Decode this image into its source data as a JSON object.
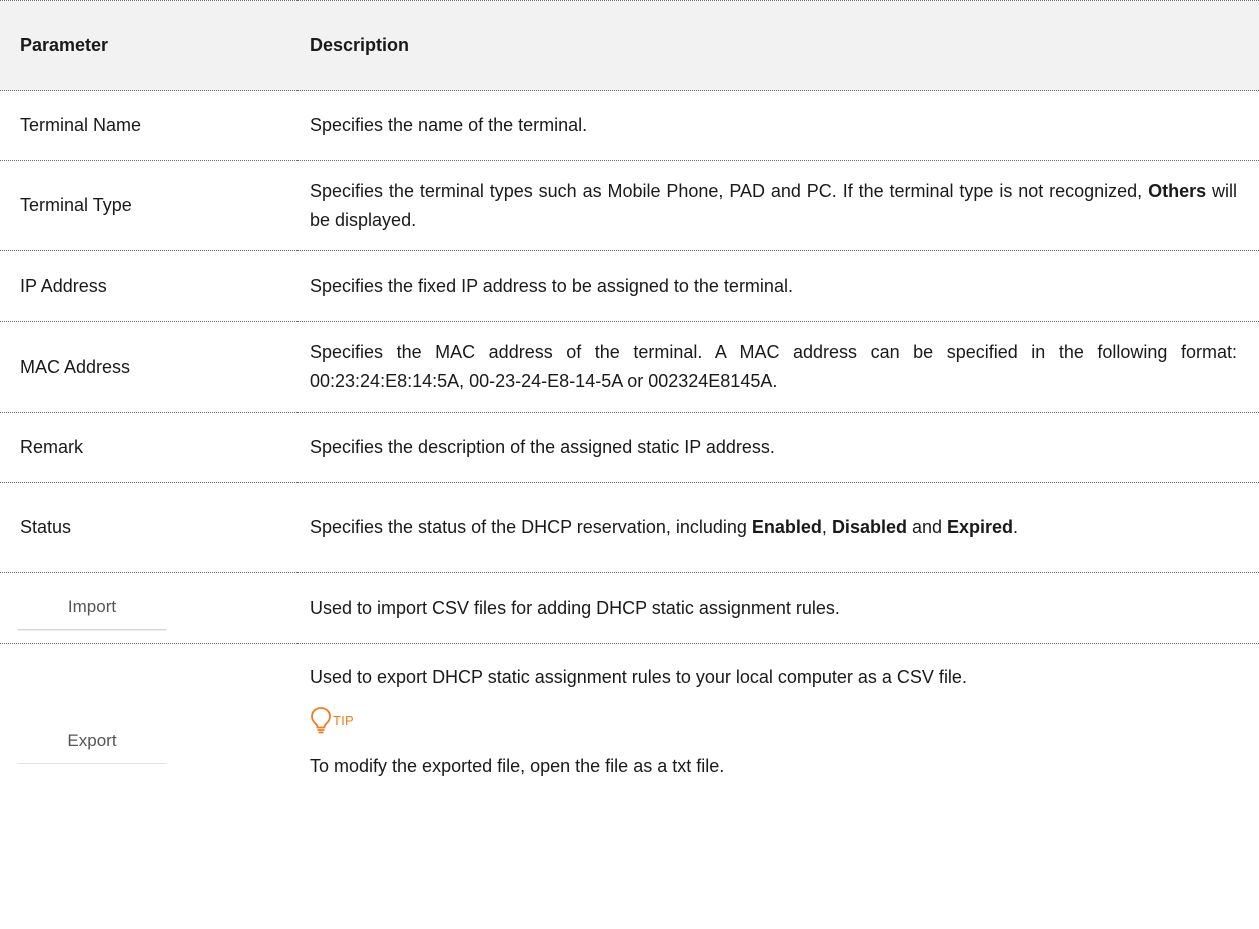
{
  "table": {
    "header": {
      "parameter": "Parameter",
      "description": "Description"
    },
    "rows": [
      {
        "parameter": "Terminal Name",
        "description": "Specifies the name of the terminal."
      },
      {
        "parameter": "Terminal Type",
        "description_before": "Specifies the terminal types such as Mobile Phone, PAD and PC. If the terminal type is not recognized, ",
        "description_bold": "Others",
        "description_after": " will be displayed."
      },
      {
        "parameter": "IP Address",
        "description": "Specifies the fixed IP address to be assigned to the terminal."
      },
      {
        "parameter": "MAC Address",
        "description": "Specifies the MAC address of the terminal. A MAC address can be specified in the following format: 00:23:24:E8:14:5A, 00-23-24-E8-14-5A or 002324E8145A."
      },
      {
        "parameter": "Remark",
        "description": "Specifies the description of the assigned static IP address."
      },
      {
        "parameter": "Status",
        "description_before": "Specifies the status of the DHCP reservation, including ",
        "bold_1": "Enabled",
        "sep_1": ", ",
        "bold_2": "Disabled",
        "sep_2": " and ",
        "bold_3": "Expired",
        "description_after": "."
      },
      {
        "parameter_button": "Import",
        "description": "Used to import CSV files for adding DHCP static assignment rules."
      },
      {
        "parameter_button": "Export",
        "description": "Used to export DHCP static assignment rules to your local computer as a CSV file.",
        "tip_icon": "lightbulb-icon",
        "tip_label": "TIP",
        "tip_text": "To modify the exported file, open the file as a txt file."
      }
    ]
  },
  "colors": {
    "header_bg": "#f2f2f2",
    "tip_accent": "#f07c1f",
    "text": "#1a1a1a"
  }
}
